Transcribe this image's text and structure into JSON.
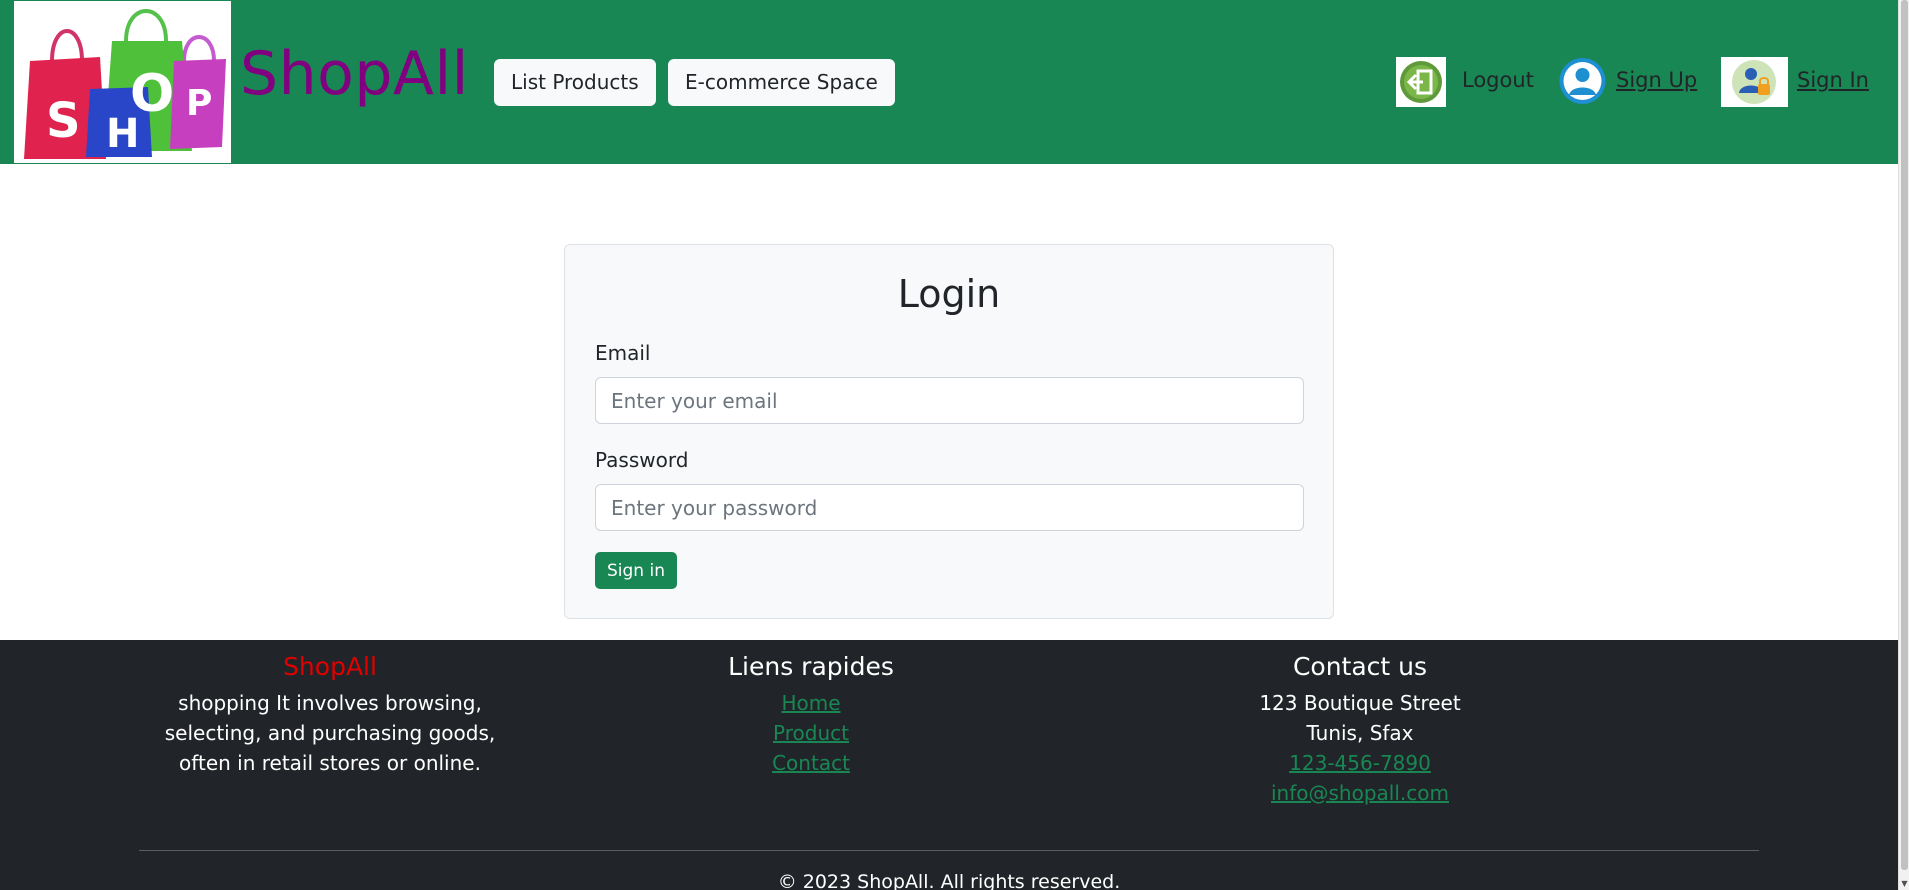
{
  "header": {
    "logo_letters": [
      "S",
      "H",
      "O",
      "P"
    ],
    "brand": "ShopAll",
    "nav_buttons": [
      "List Products",
      "E-commerce Space"
    ],
    "right_links": [
      {
        "label": "Logout",
        "icon": "logout-icon"
      },
      {
        "label": " Sign Up",
        "icon": "user-icon"
      },
      {
        "label": " Sign In",
        "icon": "user-lock-icon"
      }
    ]
  },
  "login": {
    "title": "Login",
    "email_label": "Email",
    "email_placeholder": "Enter your email",
    "password_label": "Password",
    "password_placeholder": "Enter your password",
    "submit_label": "Sign in"
  },
  "footer": {
    "about": {
      "heading": "ShopAll",
      "lines": [
        "shopping It involves browsing,",
        "selecting, and purchasing goods,",
        "often in retail stores or online."
      ]
    },
    "quick_links": {
      "heading": "Liens rapides",
      "links": [
        "Home",
        "Product",
        "Contact"
      ]
    },
    "contact": {
      "heading": "Contact us",
      "address_lines": [
        "123 Boutique Street",
        "Tunis, Sfax"
      ],
      "phone": "123-456-7890",
      "email": "info@shopall.com"
    },
    "copyright": "© 2023 ShopAll. All rights reserved."
  },
  "colors": {
    "nav_bg": "#198754",
    "brand": "#800080",
    "footer_bg": "#212529",
    "footer_brand": "#e00000",
    "link_green": "#198754",
    "button_green": "#198754"
  }
}
